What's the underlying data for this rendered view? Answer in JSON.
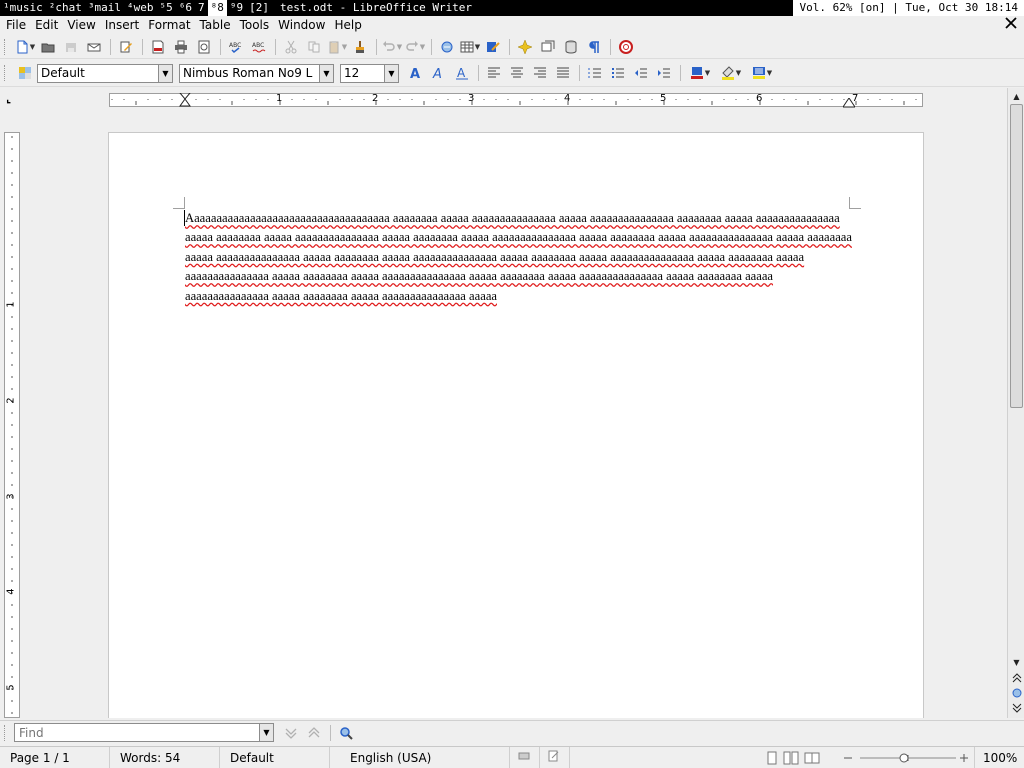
{
  "topbar": {
    "tags": [
      "¹music",
      "²chat",
      "³mail",
      "⁴web",
      "⁵5",
      "⁶6",
      "7",
      "⁸8",
      "⁹9",
      "[2]"
    ],
    "active_tag_index": 7,
    "window_title": "test.odt - LibreOffice Writer",
    "status": "Vol. 62% [on] | Tue, Oct 30 18:14"
  },
  "menubar": {
    "items": [
      "File",
      "Edit",
      "View",
      "Insert",
      "Format",
      "Table",
      "Tools",
      "Window",
      "Help"
    ],
    "close_icon": "close-icon"
  },
  "formatting": {
    "paragraph_style": "Default",
    "font_name": "Nimbus Roman No9 L",
    "font_size": "12"
  },
  "ruler": {
    "horizontal_labels": [
      "1",
      "2",
      "3",
      "4",
      "5",
      "6",
      "7"
    ],
    "vertical_labels": [
      "1",
      "2",
      "3",
      "4",
      "5"
    ]
  },
  "document": {
    "body_text": "Aaaaaaaaaaaaaaaaaaaaaaaaaaaaaaaaaaaa aaaaaaaa aaaaa aaaaaaaaaaaaaaa aaaaa aaaaaaaaaaaaaaa aaaaaaaa aaaaa aaaaaaaaaaaaaaa aaaaa aaaaaaaa aaaaa aaaaaaaaaaaaaaa aaaaa aaaaaaaa aaaaa aaaaaaaaaaaaaaa aaaaa aaaaaaaa aaaaa aaaaaaaaaaaaaaa aaaaa aaaaaaaa aaaaa aaaaaaaaaaaaaaa aaaaa aaaaaaaa aaaaa aaaaaaaaaaaaaaa aaaaa aaaaaaaa aaaaa aaaaaaaaaaaaaaa aaaaa aaaaaaaa aaaaa aaaaaaaaaaaaaaa aaaaa aaaaaaaa aaaaa aaaaaaaaaaaaaaa aaaaa aaaaaaaa aaaaa aaaaaaaaaaaaaaa aaaaa aaaaaaaa aaaaa aaaaaaaaaaaaaaa aaaaa aaaaaaaa aaaaa aaaaaaaaaaaaaaa aaaaa",
    "spellcheck_color": "#e02020"
  },
  "findbar": {
    "placeholder": "Find"
  },
  "statusbar": {
    "page": "Page 1 / 1",
    "words": "Words: 54",
    "page_style": "Default",
    "language": "English (USA)",
    "zoom": "100%"
  },
  "colors": {
    "background": "#efefef",
    "topbar_bg": "#000000",
    "accent_blue": "#2a62c8"
  }
}
